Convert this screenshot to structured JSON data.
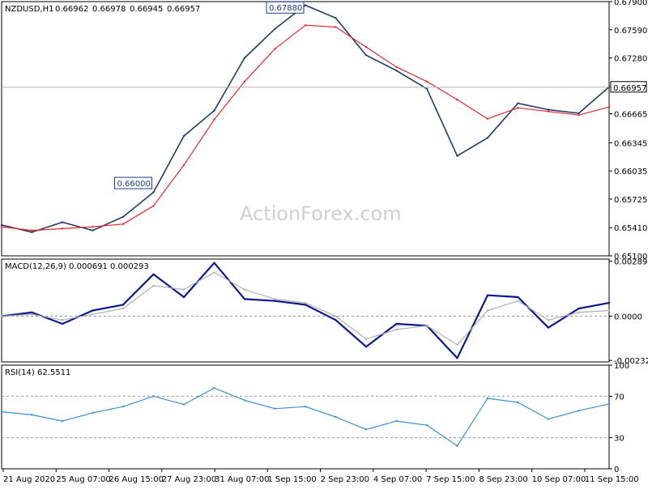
{
  "chart_data": [
    {
      "type": "line",
      "subtype": "price",
      "title": "NZDUSD,H1",
      "ohlc": [
        "0.66962",
        "0.66978",
        "0.66945",
        "0.66957"
      ],
      "last_price_label": "0.66957",
      "watermark": "ActionForex.com",
      "y_ticks": [
        "0.67900",
        "0.67590",
        "0.67280",
        "0.66665",
        "0.66345",
        "0.66035",
        "0.65725",
        "0.65410",
        "0.65100"
      ],
      "ylim": [
        0.651,
        0.679
      ],
      "annotations": [
        {
          "label": "0.67880",
          "value": 0.6788,
          "position": "high"
        },
        {
          "label": "0.66000",
          "value": 0.66,
          "position": "low"
        }
      ],
      "x": [
        0,
        5,
        10,
        15,
        20,
        25,
        30,
        35,
        40,
        45,
        50,
        55,
        60,
        65,
        70,
        75,
        80,
        85,
        90,
        95,
        100
      ],
      "series": [
        {
          "role": "close",
          "color": "#1f3a6a",
          "values": [
            0.6544,
            0.6536,
            0.6547,
            0.6538,
            0.6553,
            0.658,
            0.6642,
            0.667,
            0.6728,
            0.676,
            0.6786,
            0.6772,
            0.6731,
            0.6714,
            0.6694,
            0.662,
            0.664,
            0.6678,
            0.6671,
            0.6667,
            0.6696
          ]
        },
        {
          "role": "ma",
          "color": "#e8272c",
          "values": [
            0.6542,
            0.6538,
            0.654,
            0.6542,
            0.6545,
            0.6565,
            0.661,
            0.666,
            0.6702,
            0.6738,
            0.6764,
            0.6762,
            0.674,
            0.6718,
            0.6702,
            0.6682,
            0.6661,
            0.6673,
            0.6669,
            0.6665,
            0.6674
          ]
        }
      ]
    },
    {
      "type": "line",
      "subtype": "macd",
      "title": "MACD(12,26,9) 0.000691 0.000293",
      "y_ticks": [
        "0.002891",
        "0.0000",
        "-0.002323"
      ],
      "ylim": [
        -0.0024,
        0.003
      ],
      "x": [
        0,
        5,
        10,
        15,
        20,
        25,
        30,
        35,
        40,
        45,
        50,
        55,
        60,
        65,
        70,
        75,
        80,
        85,
        90,
        95,
        100
      ],
      "series": [
        {
          "role": "macd",
          "color": "#0a1a8c",
          "values": [
            0.0,
            0.0002,
            -0.0004,
            0.0003,
            0.0006,
            0.0022,
            0.001,
            0.0028,
            0.0009,
            0.0008,
            0.0006,
            -0.0002,
            -0.0016,
            -0.0004,
            -0.0005,
            -0.0022,
            0.0011,
            0.001,
            -0.0006,
            0.0004,
            0.0007
          ]
        },
        {
          "role": "signal",
          "color": "#b0b0b0",
          "values": [
            0.0,
            0.0001,
            -0.0002,
            0.0001,
            0.0004,
            0.0016,
            0.0014,
            0.0023,
            0.0014,
            0.0009,
            0.0007,
            0.0,
            -0.0012,
            -0.0007,
            -0.0005,
            -0.0015,
            0.0003,
            0.0008,
            -0.0002,
            0.0002,
            0.0003
          ]
        }
      ]
    },
    {
      "type": "line",
      "subtype": "rsi",
      "title": "RSI(14) 62.5511",
      "y_ticks": [
        "100",
        "70",
        "30",
        "0"
      ],
      "ylim": [
        0,
        100
      ],
      "levels": [
        70,
        30
      ],
      "x": [
        0,
        5,
        10,
        15,
        20,
        25,
        30,
        35,
        40,
        45,
        50,
        55,
        60,
        65,
        70,
        75,
        80,
        85,
        90,
        95,
        100
      ],
      "series": [
        {
          "role": "rsi",
          "color": "#3a8fd8",
          "values": [
            55,
            52,
            46,
            54,
            60,
            70,
            62,
            78,
            66,
            58,
            60,
            50,
            38,
            46,
            42,
            22,
            68,
            64,
            48,
            56,
            62.5511
          ]
        }
      ]
    }
  ],
  "x_labels": [
    "21 Aug 2020",
    "25 Aug 07:00",
    "26 Aug 15:00",
    "27 Aug 23:00",
    "31 Aug 07:00",
    "1 Sep 15:00",
    "2 Sep 23:00",
    "4 Sep 07:00",
    "7 Sep 15:00",
    "8 Sep 23:00",
    "10 Sep 07:00",
    "11 Sep 15:00"
  ]
}
